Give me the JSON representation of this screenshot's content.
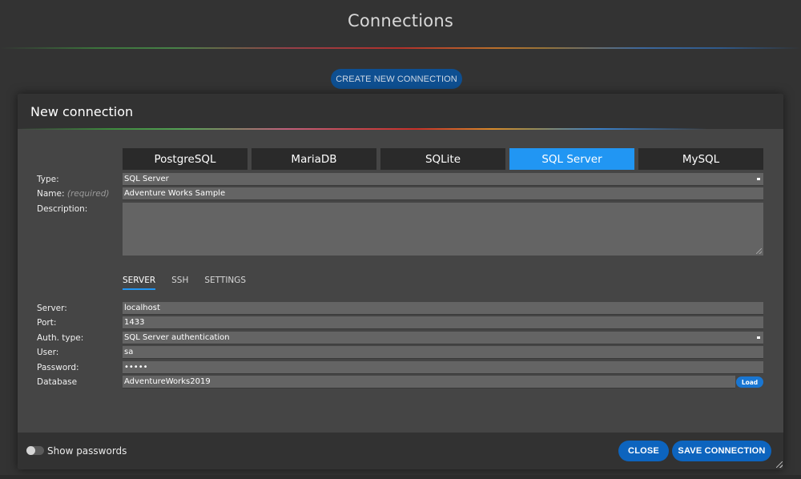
{
  "page": {
    "title": "Connections",
    "create_button": "CREATE NEW CONNECTION"
  },
  "dialog": {
    "title": "New connection",
    "db_tabs": [
      {
        "label": "PostgreSQL",
        "active": false
      },
      {
        "label": "MariaDB",
        "active": false
      },
      {
        "label": "SQLite",
        "active": false
      },
      {
        "label": "SQL Server",
        "active": true
      },
      {
        "label": "MySQL",
        "active": false
      }
    ],
    "fields": {
      "type": {
        "label": "Type:",
        "value": "SQL Server"
      },
      "name": {
        "label": "Name:",
        "hint": "(required)",
        "value": "Adventure Works Sample"
      },
      "description": {
        "label": "Description:",
        "value": ""
      }
    },
    "sub_tabs": [
      {
        "label": "SERVER",
        "active": true
      },
      {
        "label": "SSH",
        "active": false
      },
      {
        "label": "SETTINGS",
        "active": false
      }
    ],
    "server": {
      "server": {
        "label": "Server:",
        "value": "localhost"
      },
      "port": {
        "label": "Port:",
        "value": "1433"
      },
      "auth_type": {
        "label": "Auth. type:",
        "value": "SQL Server authentication"
      },
      "user": {
        "label": "User:",
        "value": "sa"
      },
      "password": {
        "label": "Password:",
        "value": "•••••"
      },
      "database": {
        "label": "Database",
        "value": "AdventureWorks2019",
        "load_button": "Load"
      }
    },
    "footer": {
      "show_passwords_label": "Show passwords",
      "show_passwords_on": false,
      "close_button": "CLOSE",
      "save_button": "SAVE CONNECTION"
    }
  },
  "colors": {
    "accent": "#2196f3",
    "button_blue": "#0d64be",
    "create_button": "#0e4f91",
    "background": "#333333",
    "dialog_body": "#454545",
    "dialog_header": "#323232"
  }
}
